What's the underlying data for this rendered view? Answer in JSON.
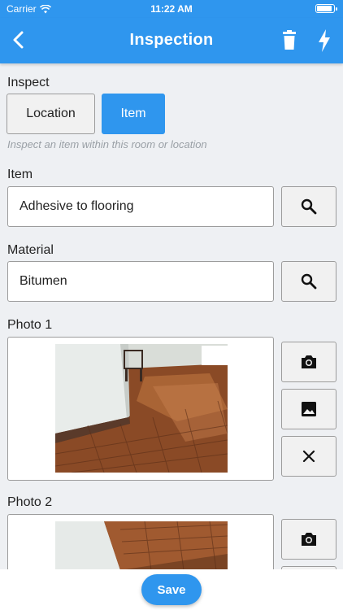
{
  "status": {
    "carrier": "Carrier",
    "time": "11:22 AM"
  },
  "nav": {
    "title": "Inspection"
  },
  "inspect": {
    "label": "Inspect",
    "options": [
      "Location",
      "Item"
    ],
    "selected": "Item",
    "hint": "Inspect an item within this room or location"
  },
  "item": {
    "label": "Item",
    "value": "Adhesive to flooring"
  },
  "material": {
    "label": "Material",
    "value": "Bitumen"
  },
  "photos": [
    {
      "label": "Photo 1"
    },
    {
      "label": "Photo 2"
    }
  ],
  "footer": {
    "save_label": "Save"
  },
  "colors": {
    "accent": "#2f96ee",
    "background": "#eef0f3"
  }
}
